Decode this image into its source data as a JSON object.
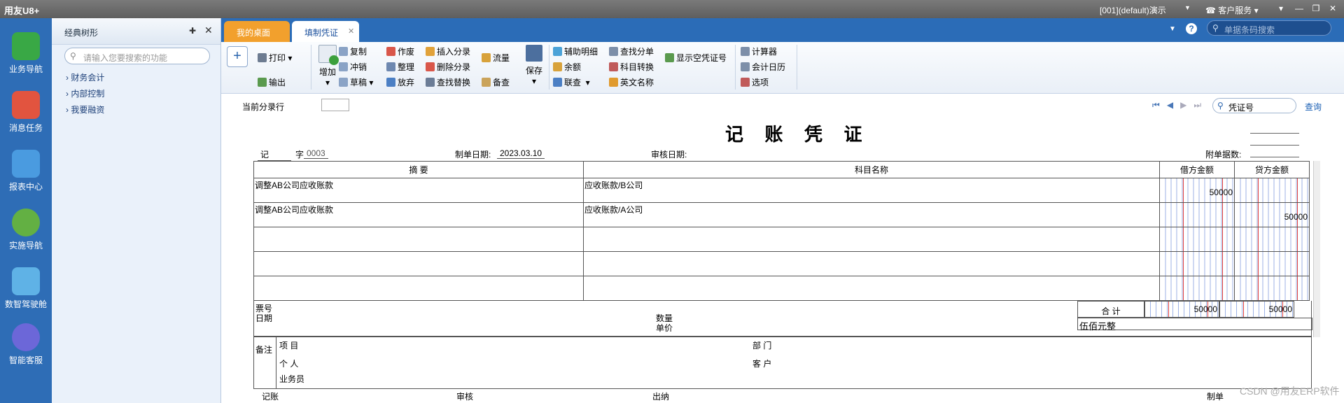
{
  "titlebar": {
    "app": "用友U8+",
    "account": "[001](default)演示",
    "service": "客户服务"
  },
  "leftnav": [
    {
      "label": "业务导航",
      "color": "#39a845"
    },
    {
      "label": "消息任务",
      "color": "#e2543f"
    },
    {
      "label": "报表中心",
      "color": "#4a9be0"
    },
    {
      "label": "实施导航",
      "color": "#63b043"
    },
    {
      "label": "数智驾驶舱",
      "color": "#5fb2e6"
    },
    {
      "label": "智能客服",
      "color": "#6c67d8"
    }
  ],
  "tree": {
    "title": "经典树形",
    "search_placeholder": "请输入您要搜索的功能",
    "items": [
      "财务会计",
      "内部控制",
      "我要融资"
    ]
  },
  "tabs": {
    "desktop": "我的桌面",
    "voucher": "填制凭证",
    "barcode_placeholder": "单据条码搜索"
  },
  "toolbar": {
    "print": "打印",
    "export": "输出",
    "add": "增加",
    "copy": "复制",
    "reverse": "冲销",
    "draft": "草稿",
    "void": "作废",
    "tidy": "整理",
    "abandon": "放弃",
    "insert": "插入分录",
    "delete": "删除分录",
    "findreplace": "查找替换",
    "flow": "流量",
    "check": "备查",
    "save": "保存",
    "aux": "辅助明细",
    "balance": "余额",
    "linkquery": "联查",
    "findentry": "查找分单",
    "acctconvert": "科目转换",
    "english": "英文名称",
    "showvoid": "显示空凭证号",
    "calculator": "计算器",
    "calendar": "会计日历",
    "options": "选项"
  },
  "form": {
    "current_entry_label": "当前分录行",
    "search_value": "凭证号",
    "query": "查询",
    "title": "记 账 凭 证",
    "type": "记",
    "zi": "字",
    "number": "0003",
    "date_label": "制单日期:",
    "date": "2023.03.10",
    "audit_label": "审核日期:",
    "attach_label": "附单据数:",
    "headers": {
      "summary": "摘 要",
      "account": "科目名称",
      "debit": "借方金额",
      "credit": "贷方金额"
    },
    "rows": [
      {
        "summary": "调整AB公司应收账款",
        "account": "应收账款/B公司",
        "debit": "50000",
        "credit": ""
      },
      {
        "summary": "调整AB公司应收账款",
        "account": "应收账款/A公司",
        "debit": "",
        "credit": "50000"
      },
      {
        "summary": "",
        "account": "",
        "debit": "",
        "credit": ""
      },
      {
        "summary": "",
        "account": "",
        "debit": "",
        "credit": ""
      },
      {
        "summary": "",
        "account": "",
        "debit": "",
        "credit": ""
      }
    ],
    "ticket_no": "票号",
    "ticket_date": "日期",
    "qty": "数量",
    "unit_price": "单价",
    "total_label": "合 计",
    "total_debit": "50000",
    "total_credit": "50000",
    "total_words": "伍佰元整",
    "remark": "备注",
    "project": "项 目",
    "dept": "部 门",
    "person": "个 人",
    "customer": "客 户",
    "salesman": "业务员",
    "sign_post": "记账",
    "sign_audit": "审核",
    "sign_cashier": "出纳",
    "sign_maker": "制单",
    "watermark": "CSDN @用友ERP软件"
  }
}
